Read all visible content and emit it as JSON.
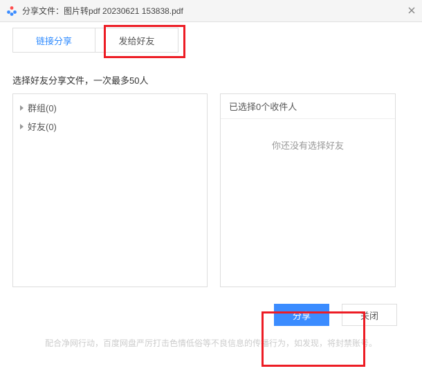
{
  "titlebar": {
    "prefix": "分享文件：",
    "filename": "图片转pdf 20230621 153838.pdf"
  },
  "tabs": {
    "link_share": "链接分享",
    "send_friend": "发给好友"
  },
  "instruction": "选择好友分享文件，一次最多50人",
  "tree": {
    "groups": "群组(0)",
    "friends": "好友(0)"
  },
  "selected_panel": {
    "prefix": "已选择",
    "count": "0",
    "suffix": "个收件人",
    "empty": "你还没有选择好友"
  },
  "buttons": {
    "share": "分享",
    "close": "关闭"
  },
  "disclaimer": "配合净网行动，百度网盘严厉打击色情低俗等不良信息的传播行为，如发现，将封禁账号。"
}
